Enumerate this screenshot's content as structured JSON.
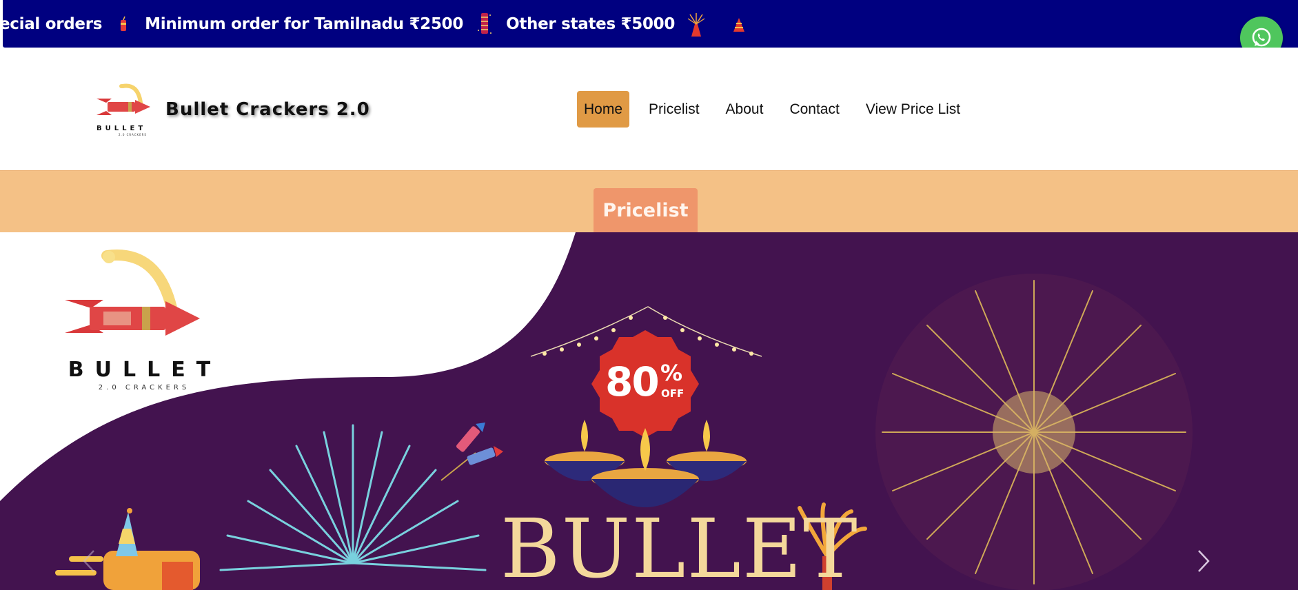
{
  "marquee": {
    "items": [
      {
        "text": "ecial orders",
        "icon": "cracker-stick-icon"
      },
      {
        "text": "Minimum order for Tamilnadu ₹2500",
        "icon": "lantern-cracker-icon"
      },
      {
        "text": "Other states ₹5000",
        "icon": "flower-pot-icon"
      }
    ]
  },
  "floating": {
    "whatsapp_icon": "whatsapp-icon",
    "pdf_icon": "pdf-icon"
  },
  "header": {
    "brand_name": "Bullet Crackers 2.0",
    "nav": [
      {
        "label": "Home",
        "active": true
      },
      {
        "label": "Pricelist",
        "active": false
      },
      {
        "label": "About",
        "active": false
      },
      {
        "label": "Contact",
        "active": false
      },
      {
        "label": "View Price List",
        "active": false
      }
    ]
  },
  "band": {
    "button_label": "Pricelist"
  },
  "hero": {
    "logo_word": "BULLET",
    "logo_sub": "2.0 CRACKERS",
    "badge_number": "80",
    "badge_percent": "%",
    "badge_off": "OFF",
    "title": "BULLET"
  },
  "colors": {
    "marquee_bg": "#000080",
    "nav_active": "#e09a45",
    "band_bg": "#f4c186",
    "band_button": "#ef966b",
    "hero_bg": "#43134f",
    "badge_red": "#d9322a",
    "hero_gold": "#f4d89b",
    "whatsapp": "#4fc65d",
    "pdf": "#d3575a"
  }
}
